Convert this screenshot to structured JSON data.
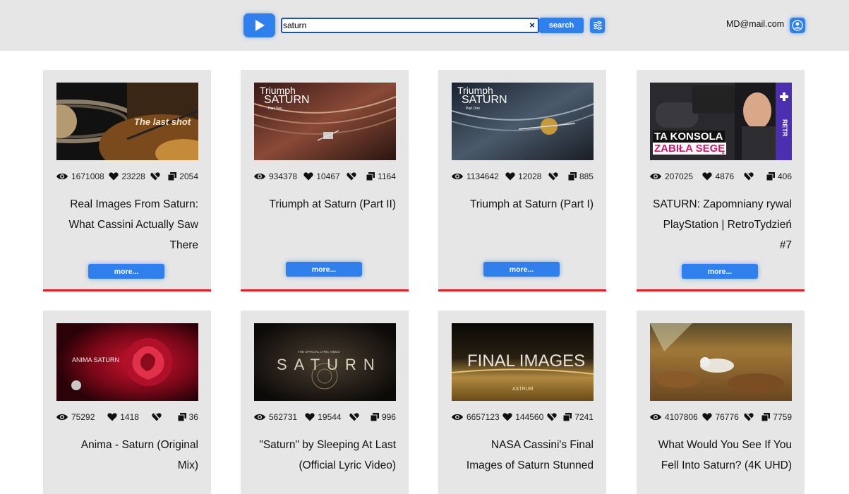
{
  "header": {
    "search_value": "saturn",
    "search_button": "search",
    "clear_symbol": "×",
    "user_email": "MD@mail.com"
  },
  "colors": {
    "accent": "#2f80ed",
    "card_bg": "#e6e6e6",
    "card_border": "#e31b23",
    "header_bg": "#e6e6e6"
  },
  "icons": {
    "views": "eye-icon",
    "likes": "heart-icon",
    "dislikes": "broken-heart-icon",
    "comments": "comments-icon"
  },
  "more_label": "more...",
  "videos": [
    {
      "views": "1671008",
      "likes": "23228",
      "dislikes": "",
      "comments": "2054",
      "title_lines": [
        "Real Images From Saturn:",
        "What Cassini Actually Saw",
        "There"
      ],
      "thumb_text": [
        "The last shot"
      ]
    },
    {
      "views": "934378",
      "likes": "10467",
      "dislikes": "",
      "comments": "1164",
      "title_lines": [
        "Triumph at Saturn (Part II)"
      ],
      "thumb_text": [
        "Triumph",
        "SATURN",
        "Part Two"
      ]
    },
    {
      "views": "1134642",
      "likes": "12028",
      "dislikes": "",
      "comments": "885",
      "title_lines": [
        "Triumph at Saturn (Part I)"
      ],
      "thumb_text": [
        "Triumph",
        "SATURN",
        "Part One"
      ]
    },
    {
      "views": "207025",
      "likes": "4876",
      "dislikes": "",
      "comments": "406",
      "title_lines": [
        "SATURN: Zapomniany rywal",
        "PlayStation | RetroTydzień",
        "#7"
      ],
      "thumb_text": [
        "TA KONSOLA",
        "ZABIŁA SEGĘ",
        "RETR"
      ]
    },
    {
      "views": "75292",
      "likes": "1418",
      "dislikes": "",
      "comments": "36",
      "title_lines": [
        "Anima - Saturn (Original",
        "Mix)"
      ],
      "thumb_text": [
        "ANIMA SATURN"
      ]
    },
    {
      "views": "562731",
      "likes": "19544",
      "dislikes": "",
      "comments": "996",
      "title_lines": [
        "\"Saturn\" by Sleeping At Last",
        "(Official Lyric Video)"
      ],
      "thumb_text": [
        "THE OFFICIAL LYRIC VIDEO",
        "SATURN"
      ]
    },
    {
      "views": "6657123",
      "likes": "144560",
      "dislikes": "",
      "comments": "7241",
      "title_lines": [
        "NASA Cassini's Final",
        "Images of Saturn Stunned"
      ],
      "thumb_text": [
        "FINAL IMAGES",
        "ASTRUM"
      ]
    },
    {
      "views": "4107806",
      "likes": "76776",
      "dislikes": "",
      "comments": "7759",
      "title_lines": [
        "What Would You See If You",
        "Fell Into Saturn? (4K UHD)"
      ],
      "thumb_text": []
    }
  ]
}
